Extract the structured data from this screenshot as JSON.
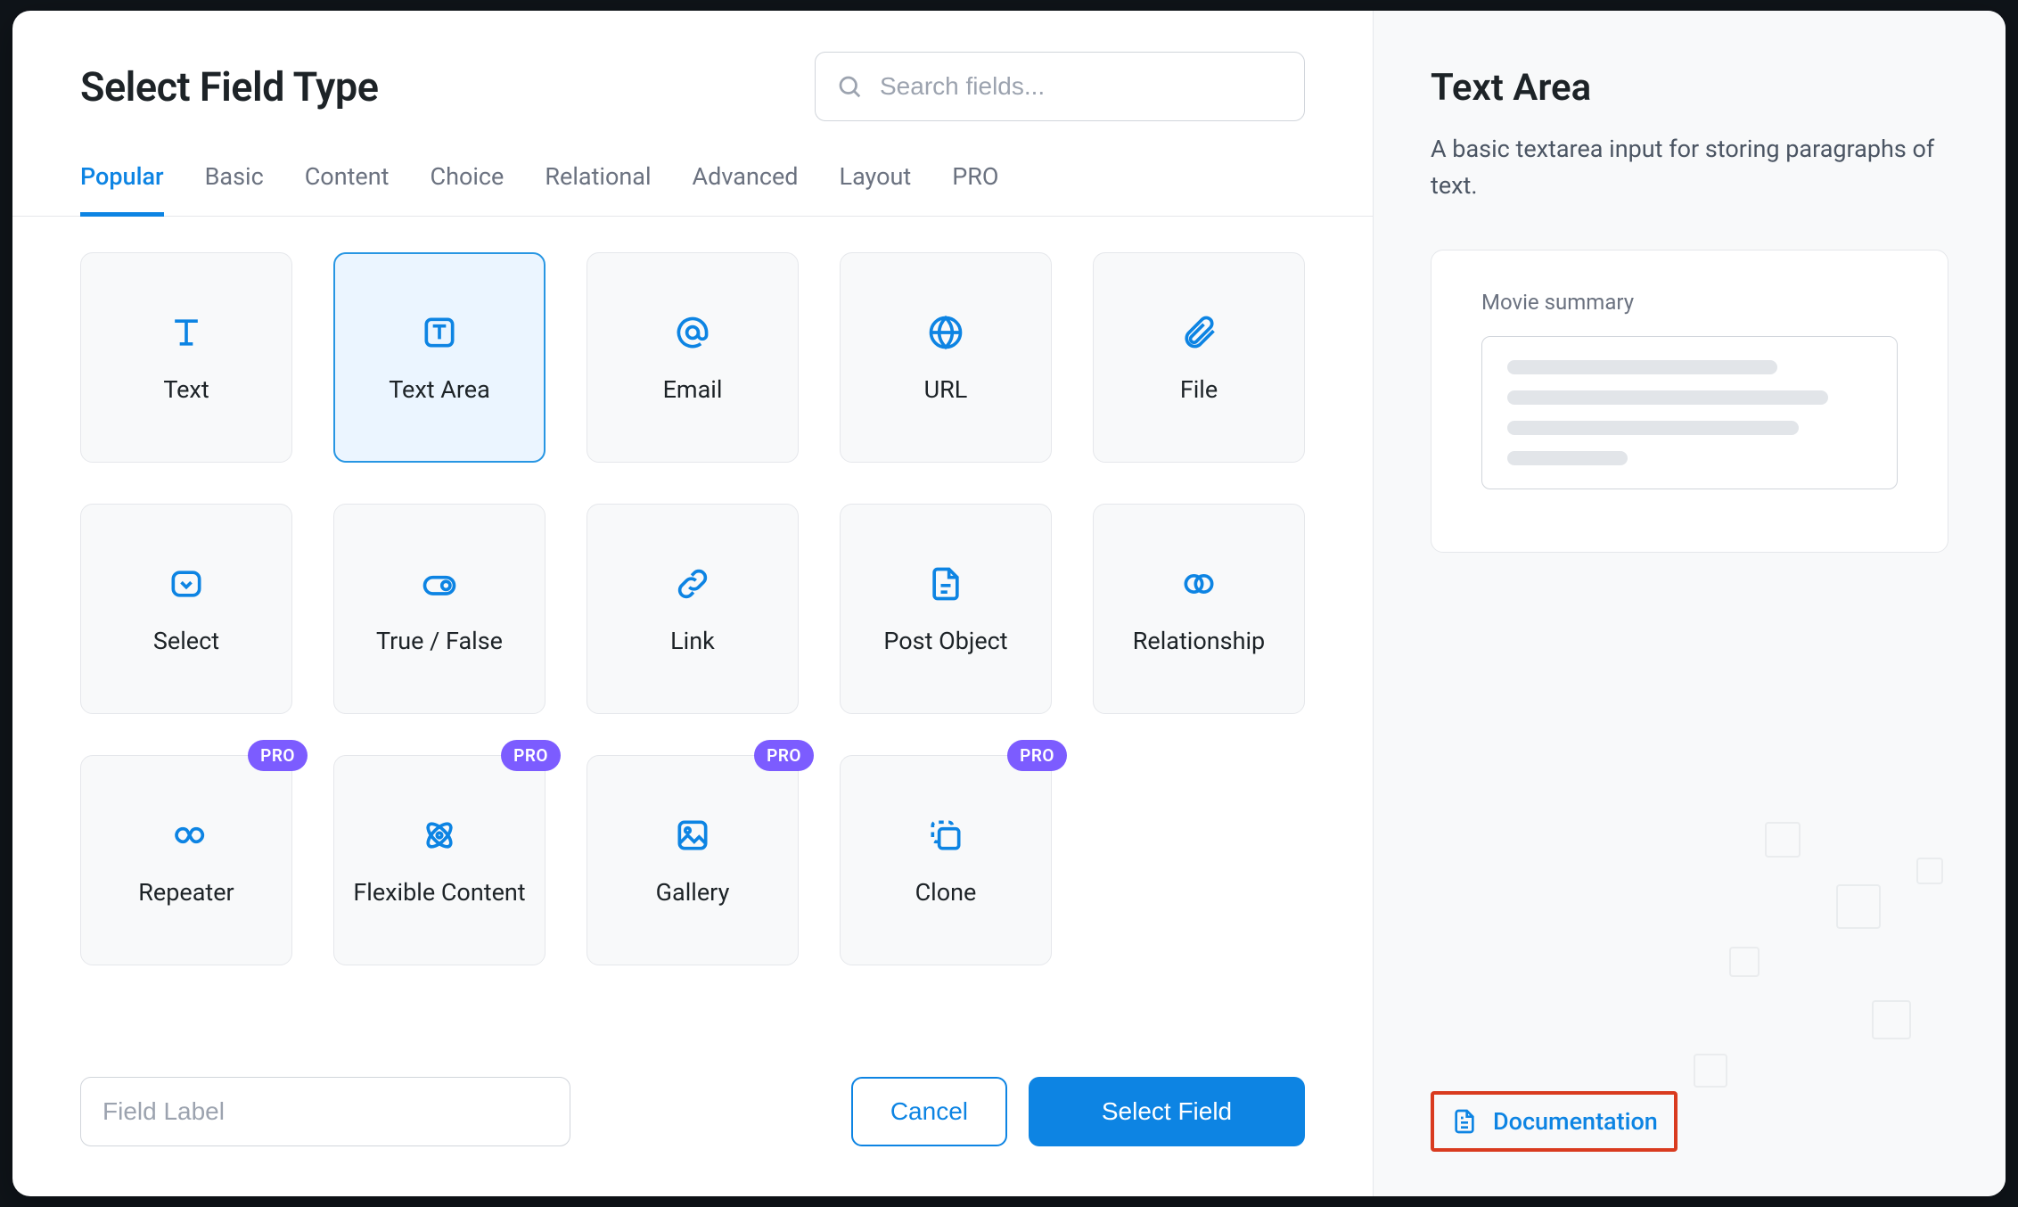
{
  "header": {
    "title": "Select Field Type",
    "search_placeholder": "Search fields..."
  },
  "tabs": [
    {
      "label": "Popular",
      "active": true
    },
    {
      "label": "Basic",
      "active": false
    },
    {
      "label": "Content",
      "active": false
    },
    {
      "label": "Choice",
      "active": false
    },
    {
      "label": "Relational",
      "active": false
    },
    {
      "label": "Advanced",
      "active": false
    },
    {
      "label": "Layout",
      "active": false
    },
    {
      "label": "PRO",
      "active": false
    }
  ],
  "fields": [
    {
      "label": "Text",
      "icon": "text",
      "selected": false,
      "pro": false
    },
    {
      "label": "Text Area",
      "icon": "textarea",
      "selected": true,
      "pro": false
    },
    {
      "label": "Email",
      "icon": "email",
      "selected": false,
      "pro": false
    },
    {
      "label": "URL",
      "icon": "url",
      "selected": false,
      "pro": false
    },
    {
      "label": "File",
      "icon": "file",
      "selected": false,
      "pro": false
    },
    {
      "label": "Select",
      "icon": "select",
      "selected": false,
      "pro": false
    },
    {
      "label": "True / False",
      "icon": "toggle",
      "selected": false,
      "pro": false
    },
    {
      "label": "Link",
      "icon": "link",
      "selected": false,
      "pro": false
    },
    {
      "label": "Post Object",
      "icon": "doc",
      "selected": false,
      "pro": false
    },
    {
      "label": "Relationship",
      "icon": "relation",
      "selected": false,
      "pro": false
    },
    {
      "label": "Repeater",
      "icon": "repeat",
      "selected": false,
      "pro": true
    },
    {
      "label": "Flexible Content",
      "icon": "flex",
      "selected": false,
      "pro": true
    },
    {
      "label": "Gallery",
      "icon": "gallery",
      "selected": false,
      "pro": true
    },
    {
      "label": "Clone",
      "icon": "clone",
      "selected": false,
      "pro": true
    }
  ],
  "pro_badge": "PRO",
  "footer": {
    "label_placeholder": "Field Label",
    "cancel": "Cancel",
    "select": "Select Field"
  },
  "right": {
    "title": "Text Area",
    "description": "A basic textarea input for storing paragraphs of text.",
    "preview_label": "Movie summary",
    "doc_link": "Documentation"
  },
  "colors": {
    "accent": "#0d84e3",
    "pro": "#7c5cff",
    "highlight_border": "#d93b1f"
  }
}
